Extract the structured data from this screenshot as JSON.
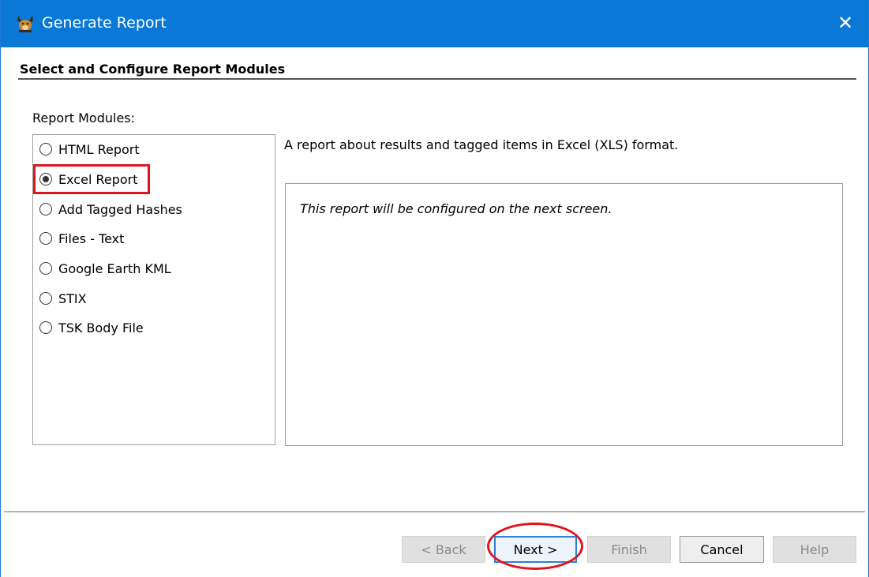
{
  "window": {
    "title": "Generate Report",
    "close_glyph": "✕",
    "accent_color": "#0a78d7"
  },
  "section_title": "Select and Configure Report Modules",
  "modules_label": "Report Modules:",
  "modules": [
    {
      "label": "HTML Report",
      "checked": false
    },
    {
      "label": "Excel Report",
      "checked": true
    },
    {
      "label": "Add Tagged Hashes",
      "checked": false
    },
    {
      "label": "Files - Text",
      "checked": false
    },
    {
      "label": "Google Earth KML",
      "checked": false
    },
    {
      "label": "STIX",
      "checked": false
    },
    {
      "label": "TSK Body File",
      "checked": false
    }
  ],
  "description": "A report about results and tagged items in Excel (XLS) format.",
  "config_message": "This report will be configured on the next screen.",
  "buttons": {
    "back": "< Back",
    "next": "Next >",
    "finish": "Finish",
    "cancel": "Cancel",
    "help": "Help"
  },
  "annotation_color": "#e1141c"
}
